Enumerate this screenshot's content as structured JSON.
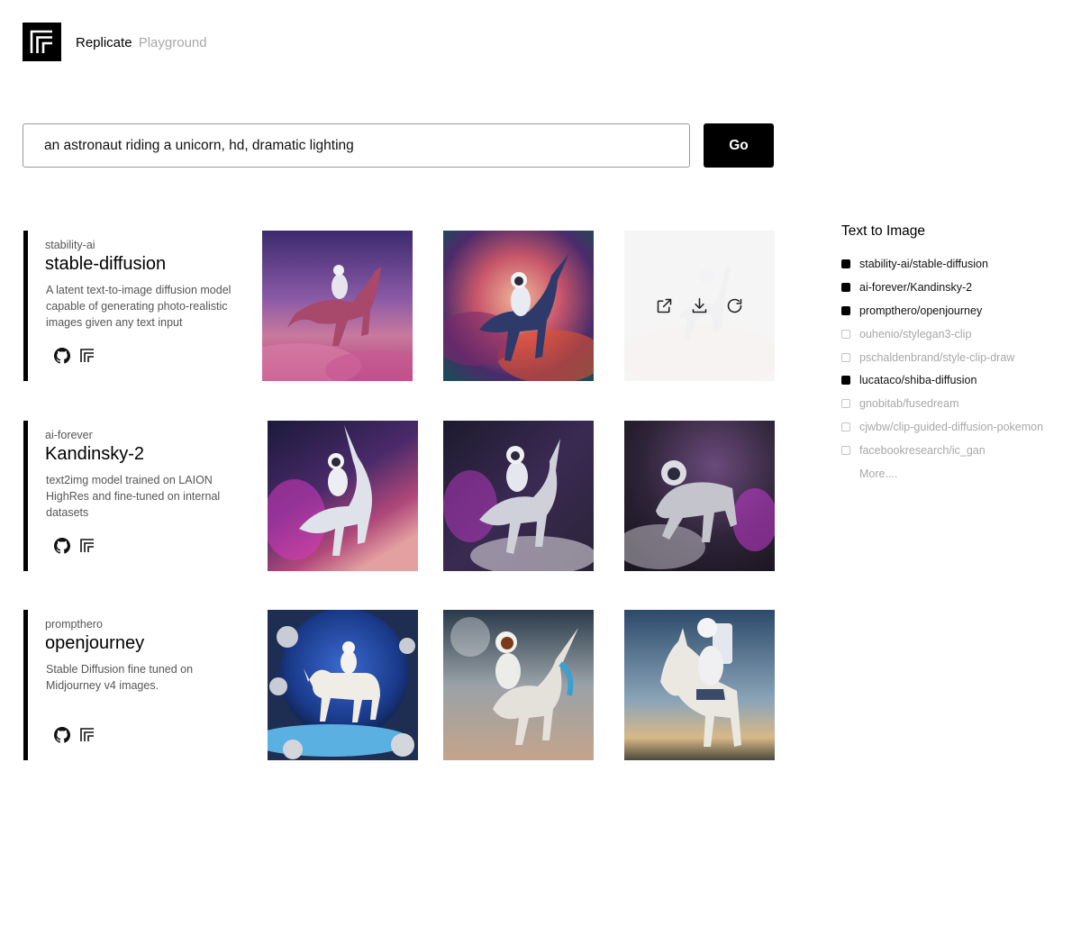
{
  "header": {
    "brand": "Replicate",
    "subtitle": "Playground"
  },
  "prompt": {
    "value": "an astronaut riding a unicorn, hd, dramatic lighting",
    "button_label": "Go"
  },
  "models": [
    {
      "owner": "stability-ai",
      "name": "stable-diffusion",
      "description": "A latent text-to-image diffusion model capable of generating photo-realistic images given any text input"
    },
    {
      "owner": "ai-forever",
      "name": "Kandinsky-2",
      "description": "text2img model trained on LAION HighRes and fine-tuned on internal datasets"
    },
    {
      "owner": "prompthero",
      "name": "openjourney",
      "description": "Stable Diffusion fine tuned on Midjourney v4 images."
    }
  ],
  "icons": {
    "github": "github-icon",
    "replicate": "replicate-logo-icon",
    "open": "open-external-icon",
    "download": "download-icon",
    "retry": "refresh-icon"
  },
  "sidebar": {
    "title": "Text to Image",
    "items": [
      {
        "label": "stability-ai/stable-diffusion",
        "checked": true
      },
      {
        "label": "ai-forever/Kandinsky-2",
        "checked": true
      },
      {
        "label": "prompthero/openjourney",
        "checked": true
      },
      {
        "label": "ouhenio/stylegan3-clip",
        "checked": false
      },
      {
        "label": "pschaldenbrand/style-clip-draw",
        "checked": false
      },
      {
        "label": "lucataco/shiba-diffusion",
        "checked": true
      },
      {
        "label": "gnobitab/fusedream",
        "checked": false
      },
      {
        "label": "cjwbw/clip-guided-diffusion-pokemon",
        "checked": false
      },
      {
        "label": "facebookresearch/ic_gan",
        "checked": false
      }
    ],
    "more": "More...."
  }
}
